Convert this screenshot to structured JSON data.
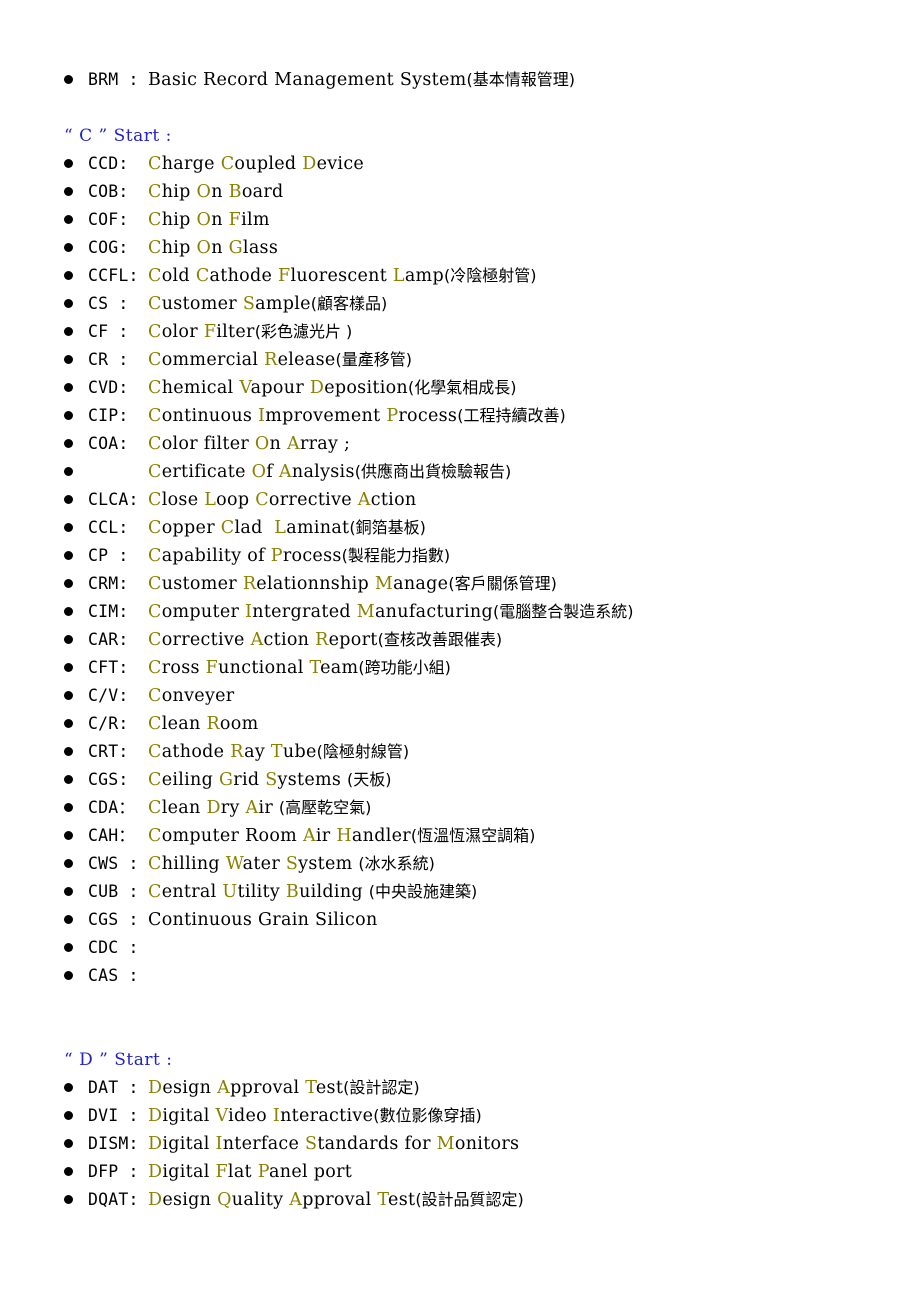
{
  "document": {
    "bullet_glyph": "●",
    "highlight_color": "#8a8000",
    "heading_color": "#2222cc",
    "body_color": "#000000",
    "background_color": "#ffffff"
  },
  "blocks": [
    {
      "kind": "entry",
      "term": "BRM :",
      "parts": [
        {
          "t": "Basic Record Management System",
          "c": "bk"
        },
        {
          "t": "(基本情報管理)",
          "c": "cjk"
        }
      ]
    },
    {
      "kind": "blank"
    },
    {
      "kind": "heading",
      "text": "“ C ” Start :"
    },
    {
      "kind": "entry",
      "term": "CCD:",
      "parts": [
        {
          "t": "C",
          "c": "hl"
        },
        {
          "t": "harge ",
          "c": "bk"
        },
        {
          "t": "C",
          "c": "hl"
        },
        {
          "t": "oupled ",
          "c": "bk"
        },
        {
          "t": "D",
          "c": "hl"
        },
        {
          "t": "evice",
          "c": "bk"
        }
      ]
    },
    {
      "kind": "entry",
      "term": "COB:",
      "parts": [
        {
          "t": "C",
          "c": "hl"
        },
        {
          "t": "hip ",
          "c": "bk"
        },
        {
          "t": "O",
          "c": "hl"
        },
        {
          "t": "n ",
          "c": "bk"
        },
        {
          "t": "B",
          "c": "hl"
        },
        {
          "t": "oard",
          "c": "bk"
        }
      ]
    },
    {
      "kind": "entry",
      "term": "COF:",
      "parts": [
        {
          "t": "C",
          "c": "hl"
        },
        {
          "t": "hip ",
          "c": "bk"
        },
        {
          "t": "O",
          "c": "hl"
        },
        {
          "t": "n ",
          "c": "bk"
        },
        {
          "t": "F",
          "c": "hl"
        },
        {
          "t": "ilm",
          "c": "bk"
        }
      ]
    },
    {
      "kind": "entry",
      "term": "COG:",
      "parts": [
        {
          "t": "C",
          "c": "hl"
        },
        {
          "t": "hip ",
          "c": "bk"
        },
        {
          "t": "O",
          "c": "hl"
        },
        {
          "t": "n ",
          "c": "bk"
        },
        {
          "t": "G",
          "c": "hl"
        },
        {
          "t": "lass",
          "c": "bk"
        }
      ]
    },
    {
      "kind": "entry",
      "term": "CCFL:",
      "parts": [
        {
          "t": "C",
          "c": "hl"
        },
        {
          "t": "old ",
          "c": "bk"
        },
        {
          "t": "C",
          "c": "hl"
        },
        {
          "t": "athode ",
          "c": "bk"
        },
        {
          "t": "F",
          "c": "hl"
        },
        {
          "t": "luorescent ",
          "c": "bk"
        },
        {
          "t": "L",
          "c": "hl"
        },
        {
          "t": "amp",
          "c": "bk"
        },
        {
          "t": "(冷陰極射管)",
          "c": "cjk"
        }
      ]
    },
    {
      "kind": "entry",
      "term": "CS :",
      "parts": [
        {
          "t": "C",
          "c": "hl"
        },
        {
          "t": "ustomer ",
          "c": "bk"
        },
        {
          "t": "S",
          "c": "hl"
        },
        {
          "t": "ample",
          "c": "bk"
        },
        {
          "t": "(顧客樣品)",
          "c": "cjk"
        }
      ]
    },
    {
      "kind": "entry",
      "term": "CF :",
      "parts": [
        {
          "t": "C",
          "c": "hl"
        },
        {
          "t": "olor ",
          "c": "bk"
        },
        {
          "t": "F",
          "c": "hl"
        },
        {
          "t": "ilter",
          "c": "bk"
        },
        {
          "t": "(彩色濾光片 )",
          "c": "cjk"
        }
      ]
    },
    {
      "kind": "entry",
      "term": "CR :",
      "parts": [
        {
          "t": "C",
          "c": "hl"
        },
        {
          "t": "ommercial ",
          "c": "bk"
        },
        {
          "t": "R",
          "c": "hl"
        },
        {
          "t": "elease",
          "c": "bk"
        },
        {
          "t": "(量產移管)",
          "c": "cjk"
        }
      ]
    },
    {
      "kind": "entry",
      "term": "CVD:",
      "parts": [
        {
          "t": "C",
          "c": "hl"
        },
        {
          "t": "hemical ",
          "c": "bk"
        },
        {
          "t": "V",
          "c": "hl"
        },
        {
          "t": "apour ",
          "c": "bk"
        },
        {
          "t": "D",
          "c": "hl"
        },
        {
          "t": "eposition",
          "c": "bk"
        },
        {
          "t": "(化學氣相成長)",
          "c": "cjk"
        }
      ]
    },
    {
      "kind": "entry",
      "term": "CIP:",
      "parts": [
        {
          "t": "C",
          "c": "hl"
        },
        {
          "t": "ontinuous ",
          "c": "bk"
        },
        {
          "t": "I",
          "c": "hl"
        },
        {
          "t": "mprovement ",
          "c": "bk"
        },
        {
          "t": "P",
          "c": "hl"
        },
        {
          "t": "rocess",
          "c": "bk"
        },
        {
          "t": "(工程持續改善)",
          "c": "cjk"
        }
      ]
    },
    {
      "kind": "entry",
      "term": "COA:",
      "parts": [
        {
          "t": "C",
          "c": "hl"
        },
        {
          "t": "olor filter ",
          "c": "bk"
        },
        {
          "t": "O",
          "c": "hl"
        },
        {
          "t": "n ",
          "c": "bk"
        },
        {
          "t": "A",
          "c": "hl"
        },
        {
          "t": "rray ;",
          "c": "bk"
        }
      ]
    },
    {
      "kind": "entry",
      "term": "",
      "parts": [
        {
          "t": "C",
          "c": "hl"
        },
        {
          "t": "ertificate ",
          "c": "bk"
        },
        {
          "t": "O",
          "c": "hl"
        },
        {
          "t": "f ",
          "c": "bk"
        },
        {
          "t": "A",
          "c": "hl"
        },
        {
          "t": "nalysis",
          "c": "bk"
        },
        {
          "t": "(供應商出貨檢驗報告)",
          "c": "cjk"
        }
      ]
    },
    {
      "kind": "entry",
      "term": "CLCA:",
      "parts": [
        {
          "t": "C",
          "c": "hl"
        },
        {
          "t": "lose ",
          "c": "bk"
        },
        {
          "t": "L",
          "c": "hl"
        },
        {
          "t": "oop ",
          "c": "bk"
        },
        {
          "t": "C",
          "c": "hl"
        },
        {
          "t": "orrective ",
          "c": "bk"
        },
        {
          "t": "A",
          "c": "hl"
        },
        {
          "t": "ction",
          "c": "bk"
        }
      ]
    },
    {
      "kind": "entry",
      "term": "CCL:",
      "parts": [
        {
          "t": "C",
          "c": "hl"
        },
        {
          "t": "opper ",
          "c": "bk"
        },
        {
          "t": "C",
          "c": "hl"
        },
        {
          "t": "lad  ",
          "c": "bk"
        },
        {
          "t": "L",
          "c": "hl"
        },
        {
          "t": "aminat",
          "c": "bk"
        },
        {
          "t": "(銅箔基板)",
          "c": "cjk"
        }
      ]
    },
    {
      "kind": "entry",
      "term": "CP :",
      "parts": [
        {
          "t": "C",
          "c": "hl"
        },
        {
          "t": "apability of ",
          "c": "bk"
        },
        {
          "t": "P",
          "c": "hl"
        },
        {
          "t": "rocess",
          "c": "bk"
        },
        {
          "t": "(製程能力指數)",
          "c": "cjk"
        }
      ]
    },
    {
      "kind": "entry",
      "term": "CRM:",
      "parts": [
        {
          "t": "C",
          "c": "hl"
        },
        {
          "t": "ustomer ",
          "c": "bk"
        },
        {
          "t": "R",
          "c": "hl"
        },
        {
          "t": "elationnship ",
          "c": "bk"
        },
        {
          "t": "M",
          "c": "hl"
        },
        {
          "t": "anage",
          "c": "bk"
        },
        {
          "t": "(客戶關係管理)",
          "c": "cjk"
        }
      ]
    },
    {
      "kind": "entry",
      "term": "CIM:",
      "parts": [
        {
          "t": "C",
          "c": "hl"
        },
        {
          "t": "omputer ",
          "c": "bk"
        },
        {
          "t": "I",
          "c": "hl"
        },
        {
          "t": "ntergrated ",
          "c": "bk"
        },
        {
          "t": "M",
          "c": "hl"
        },
        {
          "t": "anufacturing",
          "c": "bk"
        },
        {
          "t": "(電腦整合製造系統)",
          "c": "cjk"
        }
      ]
    },
    {
      "kind": "entry",
      "term": "CAR:",
      "parts": [
        {
          "t": "C",
          "c": "hl"
        },
        {
          "t": "orrective ",
          "c": "bk"
        },
        {
          "t": "A",
          "c": "hl"
        },
        {
          "t": "ction ",
          "c": "bk"
        },
        {
          "t": "R",
          "c": "hl"
        },
        {
          "t": "eport",
          "c": "bk"
        },
        {
          "t": "(查核改善跟催表)",
          "c": "cjk"
        }
      ]
    },
    {
      "kind": "entry",
      "term": "CFT:",
      "parts": [
        {
          "t": "C",
          "c": "hl"
        },
        {
          "t": "ross ",
          "c": "bk"
        },
        {
          "t": "F",
          "c": "hl"
        },
        {
          "t": "unctional ",
          "c": "bk"
        },
        {
          "t": "T",
          "c": "hl"
        },
        {
          "t": "eam",
          "c": "bk"
        },
        {
          "t": "(跨功能小組)",
          "c": "cjk"
        }
      ]
    },
    {
      "kind": "entry",
      "term": "C/V:",
      "parts": [
        {
          "t": "C",
          "c": "hl"
        },
        {
          "t": "onveyer",
          "c": "bk"
        }
      ]
    },
    {
      "kind": "entry",
      "term": "C/R:",
      "parts": [
        {
          "t": "C",
          "c": "hl"
        },
        {
          "t": "lean ",
          "c": "bk"
        },
        {
          "t": "R",
          "c": "hl"
        },
        {
          "t": "oom",
          "c": "bk"
        }
      ]
    },
    {
      "kind": "entry",
      "term": "CRT:",
      "parts": [
        {
          "t": "C",
          "c": "hl"
        },
        {
          "t": "athode ",
          "c": "bk"
        },
        {
          "t": "R",
          "c": "hl"
        },
        {
          "t": "ay ",
          "c": "bk"
        },
        {
          "t": "T",
          "c": "hl"
        },
        {
          "t": "ube",
          "c": "bk"
        },
        {
          "t": "(陰極射線管)",
          "c": "cjk"
        }
      ]
    },
    {
      "kind": "entry",
      "term": "CGS:",
      "parts": [
        {
          "t": "C",
          "c": "hl"
        },
        {
          "t": "eiling ",
          "c": "bk"
        },
        {
          "t": "G",
          "c": "hl"
        },
        {
          "t": "rid ",
          "c": "bk"
        },
        {
          "t": "S",
          "c": "hl"
        },
        {
          "t": "ystems ",
          "c": "bk"
        },
        {
          "t": "(天板)",
          "c": "cjk"
        }
      ]
    },
    {
      "kind": "entry",
      "term": "CDA：",
      "parts": [
        {
          "t": "C",
          "c": "hl"
        },
        {
          "t": "lean ",
          "c": "bk"
        },
        {
          "t": "D",
          "c": "hl"
        },
        {
          "t": "ry ",
          "c": "bk"
        },
        {
          "t": "A",
          "c": "hl"
        },
        {
          "t": "ir ",
          "c": "bk"
        },
        {
          "t": "(高壓乾空氣)",
          "c": "cjk"
        }
      ]
    },
    {
      "kind": "entry",
      "term": "CAH：",
      "parts": [
        {
          "t": "C",
          "c": "hl"
        },
        {
          "t": "omputer Room ",
          "c": "bk"
        },
        {
          "t": "A",
          "c": "hl"
        },
        {
          "t": "ir ",
          "c": "bk"
        },
        {
          "t": "H",
          "c": "hl"
        },
        {
          "t": "andler",
          "c": "bk"
        },
        {
          "t": "(恆溫恆濕空調箱)",
          "c": "cjk"
        }
      ]
    },
    {
      "kind": "entry",
      "term": "CWS :",
      "parts": [
        {
          "t": "C",
          "c": "hl"
        },
        {
          "t": "hilling ",
          "c": "bk"
        },
        {
          "t": "W",
          "c": "hl"
        },
        {
          "t": "ater ",
          "c": "bk"
        },
        {
          "t": "S",
          "c": "hl"
        },
        {
          "t": "ystem ",
          "c": "bk"
        },
        {
          "t": "(冰水系統)",
          "c": "cjk"
        }
      ]
    },
    {
      "kind": "entry",
      "term": "CUB :",
      "parts": [
        {
          "t": "C",
          "c": "hl"
        },
        {
          "t": "entral ",
          "c": "bk"
        },
        {
          "t": "U",
          "c": "hl"
        },
        {
          "t": "tility ",
          "c": "bk"
        },
        {
          "t": "B",
          "c": "hl"
        },
        {
          "t": "uilding ",
          "c": "bk"
        },
        {
          "t": "(中央設施建築)",
          "c": "cjk"
        }
      ]
    },
    {
      "kind": "entry",
      "term": "CGS :",
      "parts": [
        {
          "t": "Continuous Grain Silicon",
          "c": "bk"
        }
      ]
    },
    {
      "kind": "entry",
      "term": "CDC :",
      "parts": []
    },
    {
      "kind": "entry",
      "term": "CAS :",
      "parts": []
    },
    {
      "kind": "blank"
    },
    {
      "kind": "blank"
    },
    {
      "kind": "heading",
      "text": "“ D ” Start :"
    },
    {
      "kind": "entry",
      "term": "DAT :",
      "parts": [
        {
          "t": "D",
          "c": "hl"
        },
        {
          "t": "esign ",
          "c": "bk"
        },
        {
          "t": "A",
          "c": "hl"
        },
        {
          "t": "pproval ",
          "c": "bk"
        },
        {
          "t": "T",
          "c": "hl"
        },
        {
          "t": "est",
          "c": "bk"
        },
        {
          "t": "(設計認定)",
          "c": "cjk"
        }
      ]
    },
    {
      "kind": "entry",
      "term": "DVI :",
      "parts": [
        {
          "t": "D",
          "c": "hl"
        },
        {
          "t": "igital ",
          "c": "bk"
        },
        {
          "t": "V",
          "c": "hl"
        },
        {
          "t": "ideo ",
          "c": "bk"
        },
        {
          "t": "I",
          "c": "hl"
        },
        {
          "t": "nteractive",
          "c": "bk"
        },
        {
          "t": "(數位影像穿插)",
          "c": "cjk"
        }
      ]
    },
    {
      "kind": "entry",
      "term": "DISM:",
      "parts": [
        {
          "t": "D",
          "c": "hl"
        },
        {
          "t": "igital ",
          "c": "bk"
        },
        {
          "t": "I",
          "c": "hl"
        },
        {
          "t": "nterface ",
          "c": "bk"
        },
        {
          "t": "S",
          "c": "hl"
        },
        {
          "t": "tandards for ",
          "c": "bk"
        },
        {
          "t": "M",
          "c": "hl"
        },
        {
          "t": "onitors",
          "c": "bk"
        }
      ]
    },
    {
      "kind": "entry",
      "term": "DFP :",
      "parts": [
        {
          "t": "D",
          "c": "hl"
        },
        {
          "t": "igital ",
          "c": "bk"
        },
        {
          "t": "F",
          "c": "hl"
        },
        {
          "t": "lat ",
          "c": "bk"
        },
        {
          "t": "P",
          "c": "hl"
        },
        {
          "t": "anel port",
          "c": "bk"
        }
      ]
    },
    {
      "kind": "entry",
      "term": "DQAT:",
      "parts": [
        {
          "t": "D",
          "c": "hl"
        },
        {
          "t": "esign ",
          "c": "bk"
        },
        {
          "t": "Q",
          "c": "hl"
        },
        {
          "t": "uality ",
          "c": "bk"
        },
        {
          "t": "A",
          "c": "hl"
        },
        {
          "t": "pproval ",
          "c": "bk"
        },
        {
          "t": "T",
          "c": "hl"
        },
        {
          "t": "est",
          "c": "bk"
        },
        {
          "t": "(設計品質認定)",
          "c": "cjk"
        }
      ]
    }
  ]
}
